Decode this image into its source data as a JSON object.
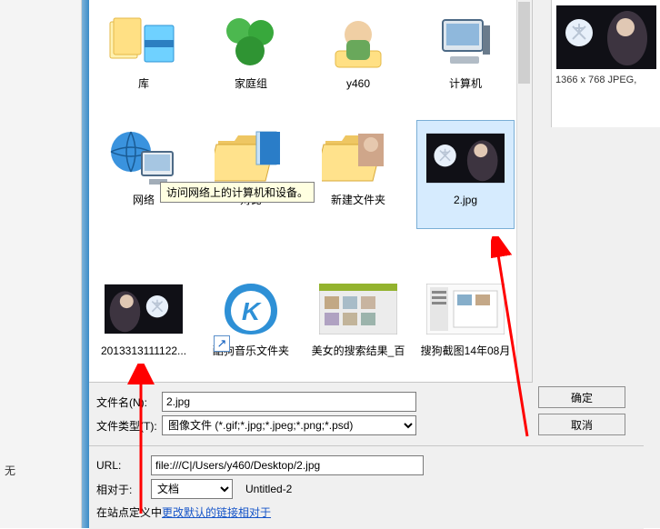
{
  "left": {
    "no_text": "无"
  },
  "tooltip": "访问网络上的计算机和设备。",
  "items_row1": [
    {
      "label": "库"
    },
    {
      "label": "家庭组"
    },
    {
      "label": "y460"
    },
    {
      "label": "计算机"
    }
  ],
  "items_row2": [
    {
      "label": "网络"
    },
    {
      "label": "对比"
    },
    {
      "label": "新建文件夹"
    },
    {
      "label": "2.jpg"
    }
  ],
  "items_row3": [
    {
      "label": "2013313111122..."
    },
    {
      "label": "酷狗音乐文件夹"
    },
    {
      "label": "美女的搜索结果_百"
    },
    {
      "label": "搜狗截图14年08月"
    }
  ],
  "form": {
    "filename_label": "文件名(N):",
    "filetype_label": "文件类型(T):",
    "filename_value": "2.jpg",
    "filetype_value": "图像文件 (*.gif;*.jpg;*.jpeg;*.png;*.psd)",
    "ok": "确定",
    "cancel": "取消"
  },
  "lower": {
    "url_label": "URL:",
    "url_value": "file:///C|/Users/y460/Desktop/2.jpg",
    "rel_label": "相对于:",
    "rel_select": "文档",
    "rel_value": "Untitled-2",
    "tip_prefix": "在站点定义中",
    "tip_link": "更改默认的链接相对于"
  },
  "preview": {
    "caption": "1366 x 768 JPEG,"
  }
}
